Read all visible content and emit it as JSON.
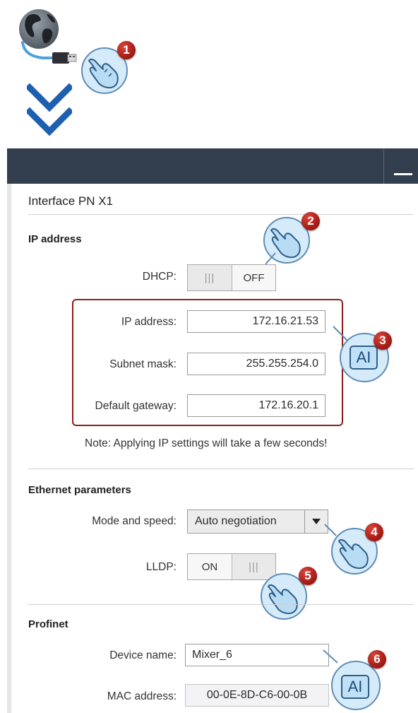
{
  "panel": {
    "title": "Interface PN X1"
  },
  "ip_section": {
    "title": "IP address",
    "dhcp_label": "DHCP:",
    "dhcp_grip": "|||",
    "dhcp_state": "OFF",
    "ip_label": "IP address:",
    "ip_value": "172.16.21.53",
    "subnet_label": "Subnet mask:",
    "subnet_value": "255.255.254.0",
    "gateway_label": "Default gateway:",
    "gateway_value": "172.16.20.1",
    "note": "Note: Applying IP settings will take a few seconds!"
  },
  "ethernet_section": {
    "title": "Ethernet parameters",
    "mode_label": "Mode and speed:",
    "mode_value": "Auto negotiation",
    "lldp_label": "LLDP:",
    "lldp_state": "ON",
    "lldp_grip": "|||"
  },
  "profinet_section": {
    "title": "Profinet",
    "device_name_label": "Device name:",
    "device_name_value": "Mixer_6",
    "mac_label": "MAC address:",
    "mac_value": "00-0E-8D-C6-00-0B"
  },
  "callouts": {
    "step1": "1",
    "step2": "2",
    "step3": "3",
    "step4": "4",
    "step5": "5",
    "step6": "6",
    "ai_text": "AI"
  },
  "colors": {
    "titlebar": "#323e4d",
    "highlight_border": "#8c1d1d",
    "badge": "#a71d17",
    "chevron": "#1f5fb0",
    "hand": "#9ec9ec"
  }
}
